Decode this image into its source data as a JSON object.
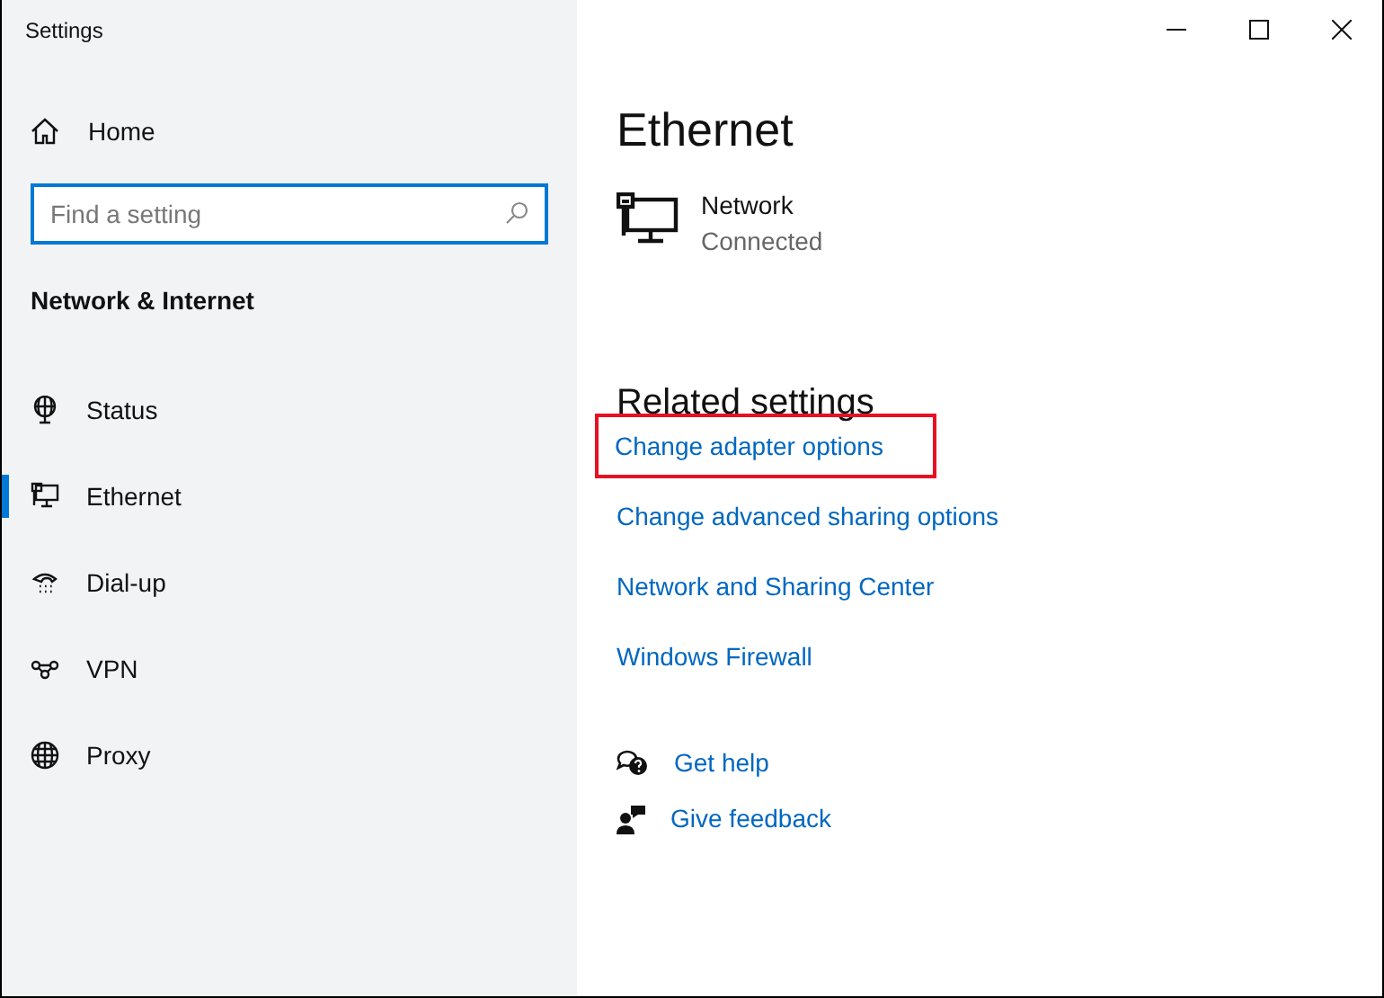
{
  "window": {
    "title": "Settings"
  },
  "sidebar": {
    "home": "Home",
    "search": {
      "placeholder": "Find a setting"
    },
    "section": "Network & Internet",
    "items": [
      {
        "label": "Status",
        "kind": "status",
        "selected": false
      },
      {
        "label": "Ethernet",
        "kind": "ethernet",
        "selected": true
      },
      {
        "label": "Dial-up",
        "kind": "dialup",
        "selected": false
      },
      {
        "label": "VPN",
        "kind": "vpn",
        "selected": false
      },
      {
        "label": "Proxy",
        "kind": "proxy",
        "selected": false
      }
    ]
  },
  "main": {
    "title": "Ethernet",
    "network": {
      "name": "Network",
      "status": "Connected"
    },
    "related_title": "Related settings",
    "links": [
      {
        "label": "Change adapter options",
        "highlighted": true
      },
      {
        "label": "Change advanced sharing options",
        "highlighted": false
      },
      {
        "label": "Network and Sharing Center",
        "highlighted": false
      },
      {
        "label": "Windows Firewall",
        "highlighted": false
      }
    ],
    "help": [
      {
        "label": "Get help",
        "kind": "help"
      },
      {
        "label": "Give feedback",
        "kind": "feedback"
      }
    ]
  }
}
